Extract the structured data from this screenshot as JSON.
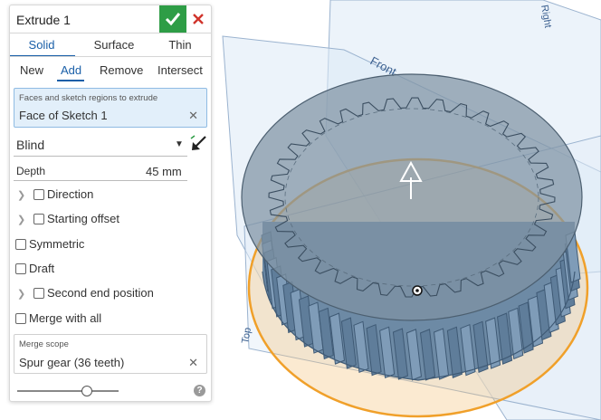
{
  "viewport": {
    "plane_front_label": "Front",
    "plane_right_label": "Right",
    "plane_top_label": "Top",
    "colors": {
      "gear_fill": "#6d8aa5",
      "cap_fill": "#7f93a4",
      "selection": "#f0a02a",
      "plane": "#cfe0f2"
    }
  },
  "panel": {
    "title": "Extrude 1",
    "accept_icon": "check-icon",
    "cancel_icon": "close-icon",
    "type_tabs": [
      "Solid",
      "Surface",
      "Thin"
    ],
    "active_type": "Solid",
    "operations": [
      "New",
      "Add",
      "Remove",
      "Intersect"
    ],
    "active_operation": "Add",
    "faces": {
      "label": "Faces and sketch regions to extrude",
      "value": "Face of Sketch 1"
    },
    "end_type": "Blind",
    "depth": {
      "label": "Depth",
      "value": "45 mm"
    },
    "options": {
      "direction": "Direction",
      "starting_offset": "Starting offset",
      "symmetric": "Symmetric",
      "draft": "Draft",
      "second_end": "Second end position",
      "merge_with_all": "Merge with all"
    },
    "merge_scope": {
      "label": "Merge scope",
      "value": "Spur gear (36 teeth)"
    },
    "help": "?",
    "colors": {
      "accent": "#1a5fa8",
      "accept": "#2e9d46",
      "cancel": "#d0342c",
      "field_bg": "#e2effa"
    }
  }
}
